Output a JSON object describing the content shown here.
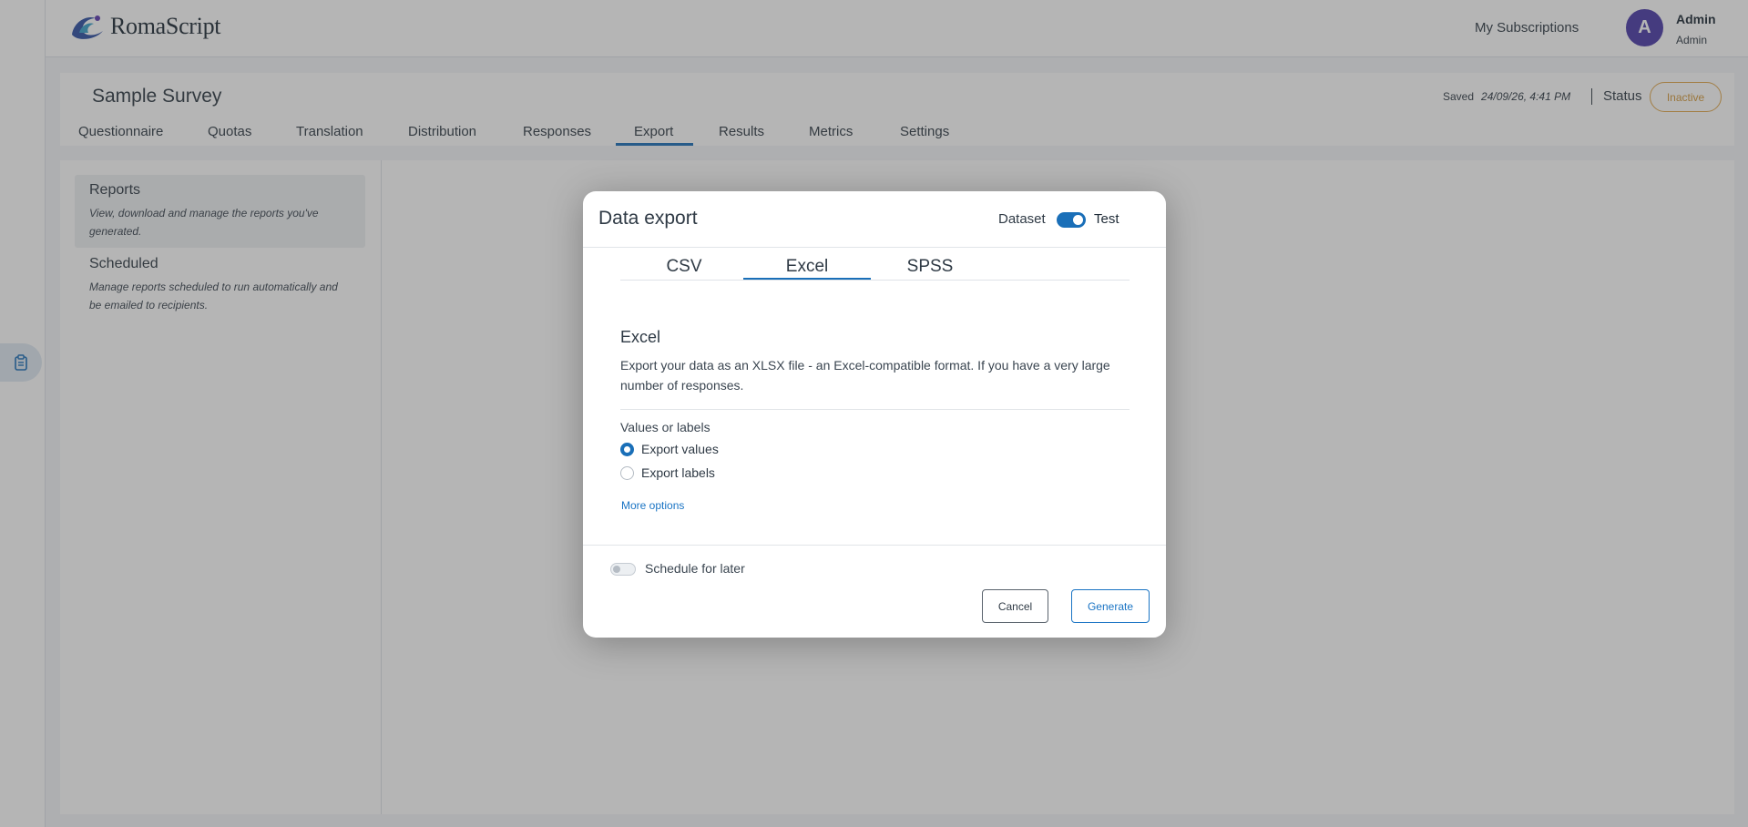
{
  "app": {
    "logo_text": "RomaScript",
    "subscriptions_link": "My Subscriptions",
    "user": {
      "initial": "A",
      "name": "Admin",
      "role": "Admin"
    }
  },
  "survey": {
    "title": "Sample Survey",
    "saved_label": "Saved",
    "saved_timestamp": "24/09/26, 4:41 PM",
    "status_label": "Status",
    "status_value": "Inactive",
    "tabs": [
      "Questionnaire",
      "Quotas",
      "Translation",
      "Distribution",
      "Responses",
      "Export",
      "Results",
      "Metrics",
      "Settings"
    ],
    "active_tab": "Export"
  },
  "sidenav": {
    "items": [
      {
        "title": "Reports",
        "desc": "View, download and manage the reports you've generated."
      },
      {
        "title": "Scheduled",
        "desc": "Manage reports scheduled to run automatically and be emailed to recipients."
      }
    ]
  },
  "modal": {
    "title": "Data export",
    "dataset_label": "Dataset",
    "dataset_toggle_on": true,
    "dataset_value": "Test",
    "tabs": [
      "CSV",
      "Excel",
      "SPSS"
    ],
    "active_tab": "Excel",
    "section_title": "Excel",
    "section_desc": "Export your data as an XLSX file - an Excel-compatible format. If you have a very large number of responses.",
    "values_or_labels_label": "Values or labels",
    "options": [
      {
        "label": "Export values",
        "checked": true
      },
      {
        "label": "Export labels",
        "checked": false
      }
    ],
    "more_options": "More options",
    "schedule_label": "Schedule for later",
    "schedule_on": false,
    "cancel_label": "Cancel",
    "generate_label": "Generate"
  },
  "colors": {
    "accent": "#1a6fb8",
    "avatar": "#4b3aa8",
    "status_inactive": "#d49a3c"
  }
}
